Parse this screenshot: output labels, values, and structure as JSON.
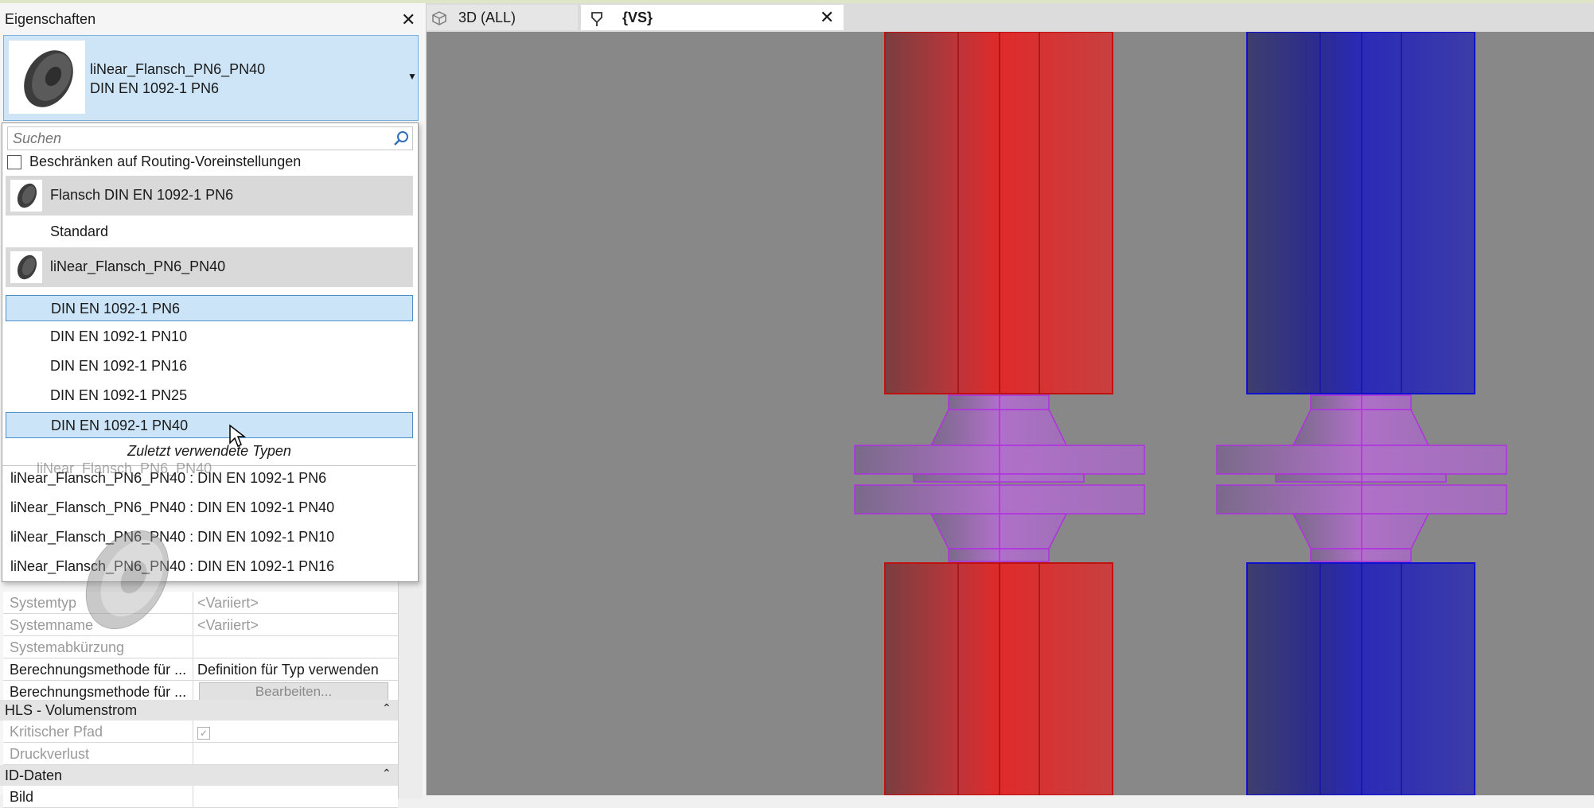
{
  "properties_panel": {
    "title": "Eigenschaften",
    "type_selector": {
      "family": "liNear_Flansch_PN6_PN40",
      "type": "DIN EN 1092-1 PN6"
    },
    "search": {
      "placeholder": "Suchen",
      "value": ""
    },
    "restrict_label": "Beschränken auf Routing-Voreinstellungen",
    "groups": [
      {
        "label": "Flansch DIN EN 1092-1 PN6",
        "items": [
          "Standard"
        ]
      },
      {
        "label": "liNear_Flansch_PN6_PN40",
        "items": [
          "DIN EN 1092-1 PN6",
          "DIN EN 1092-1 PN10",
          "DIN EN 1092-1 PN16",
          "DIN EN 1092-1 PN25",
          "DIN EN 1092-1 PN40"
        ]
      }
    ],
    "recent_header": "Zuletzt verwendete Typen",
    "recent_items": [
      "liNear_Flansch_PN6_PN40 : DIN EN 1092-1 PN6",
      "liNear_Flansch_PN6_PN40 : DIN EN 1092-1 PN40",
      "liNear_Flansch_PN6_PN40 : DIN EN 1092-1 PN10",
      "liNear_Flansch_PN6_PN40 : DIN EN 1092-1 PN16"
    ],
    "drag_ghost_label": "liNear_Flansch_PN6_PN40",
    "grid_rows": [
      {
        "name": "Systemtyp",
        "value": "<Variiert>"
      },
      {
        "name": "Systemname",
        "value": "<Variiert>"
      },
      {
        "name": "Systemabkürzung",
        "value": ""
      },
      {
        "name": "Berechnungsmethode für ...",
        "value": "Definition für Typ verwenden"
      },
      {
        "name": "Berechnungsmethode für ...",
        "button": "Bearbeiten..."
      }
    ],
    "section_volumenstrom": "HLS - Volumenstrom",
    "volumenstrom_rows": [
      {
        "name": "Kritischer Pfad",
        "value": ""
      },
      {
        "name": "Druckverlust",
        "value": ""
      }
    ],
    "section_id": "ID-Daten",
    "id_rows": [
      {
        "name": "Bild",
        "value": ""
      }
    ]
  },
  "tabs": [
    {
      "label": "3D (ALL)"
    },
    {
      "label": "{VS}"
    }
  ],
  "colors": {
    "selection": "#cce4f7",
    "red_pipe": "#d94040",
    "blue_pipe": "#3a3ab0",
    "flange": "#b070c8",
    "viewport_bg": "#888888"
  }
}
